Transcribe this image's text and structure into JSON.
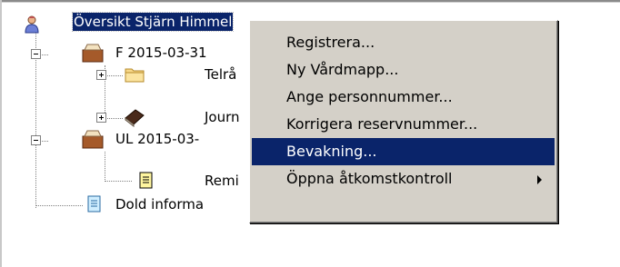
{
  "tree": {
    "root": {
      "label": "Översikt Stjärn Himmel",
      "icon": "user-icon"
    },
    "nodes": [
      {
        "label": "F 2015-03-31",
        "icon": "folder-box-icon"
      },
      {
        "label": "Telrå",
        "icon": "folder-icon"
      },
      {
        "label": "Journ",
        "icon": "book-icon"
      },
      {
        "label": "UL 2015-03-",
        "icon": "folder-box-icon"
      },
      {
        "label": "Remi",
        "icon": "document-yellow-icon"
      },
      {
        "label": "Dold informa",
        "icon": "document-blue-icon"
      }
    ]
  },
  "context_menu": {
    "items": [
      {
        "label": "Registrera..."
      },
      {
        "label": "Ny Vårdmapp..."
      },
      {
        "label": "Ange personnummer..."
      },
      {
        "label": "Korrigera reservnummer..."
      },
      {
        "label": "Bevakning...",
        "highlighted": true
      },
      {
        "label": "Öppna åtkomstkontroll",
        "has_submenu": true
      }
    ]
  },
  "colors": {
    "selection": "#0a246a",
    "menu_background": "#d4d0c8"
  }
}
